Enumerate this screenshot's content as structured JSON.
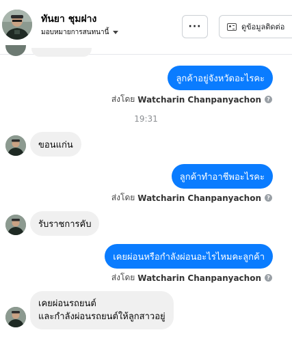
{
  "header": {
    "contact_name": "ทันยา ชุมฝาง",
    "assign_label": "มอบหมายการสนทนานี้",
    "more_label": "···",
    "contact_info_label": "ดูข้อมูลติดต่อ"
  },
  "messages": [
    {
      "direction": "outgoing",
      "text": "ลูกค้าอยู่จังหวัดอะไรคะ",
      "sent_by_prefix": "ส่งโดย",
      "sent_by_name": "Watcharin Chanpanyachon",
      "help_icon": "?"
    },
    {
      "direction": "incoming",
      "text": "ขอนแก่น"
    },
    {
      "direction": "outgoing",
      "text": "ลูกค้าทำอาชีพอะไรคะ",
      "sent_by_prefix": "ส่งโดย",
      "sent_by_name": "Watcharin Chanpanyachon",
      "help_icon": "?"
    },
    {
      "direction": "incoming",
      "text": "รับราชการคับ"
    },
    {
      "direction": "outgoing",
      "text": "เคยผ่อนหรือกำลังผ่อนอะไรไหมคะลูกค้า",
      "sent_by_prefix": "ส่งโดย",
      "sent_by_name": "Watcharin Chanpanyachon",
      "help_icon": "?"
    },
    {
      "direction": "incoming",
      "lines": [
        "เคยผ่อนรถยนต์",
        "และกำลังผ่อนรถยนต์ให้ลูกสาวอยู่"
      ]
    }
  ],
  "timestamp": "19:31",
  "colors": {
    "outgoing_bubble": "#0a7cff",
    "incoming_bubble": "#f0f0f0",
    "timestamp": "#8a8d91"
  }
}
